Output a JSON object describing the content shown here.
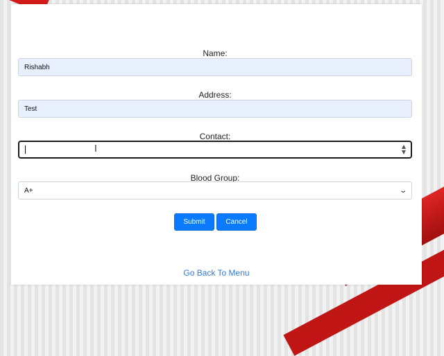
{
  "form": {
    "name": {
      "label": "Name:",
      "value": "Rishabh"
    },
    "address": {
      "label": "Address:",
      "value": "Test"
    },
    "contact": {
      "label": "Contact:",
      "value": ""
    },
    "blood_group": {
      "label": "Blood Group:",
      "selected": "A+"
    }
  },
  "buttons": {
    "submit": "Submit",
    "cancel": "Cancel"
  },
  "links": {
    "back": "Go Back To Menu"
  },
  "colors": {
    "primary_button": "#0a7bff",
    "autofill_bg": "#e8f0fe",
    "link": "#2f7de1",
    "ribbon": "#d21c1c"
  },
  "icons": [
    "text-cursor-icon",
    "spinner-arrows-icon",
    "chevron-down-icon"
  ]
}
